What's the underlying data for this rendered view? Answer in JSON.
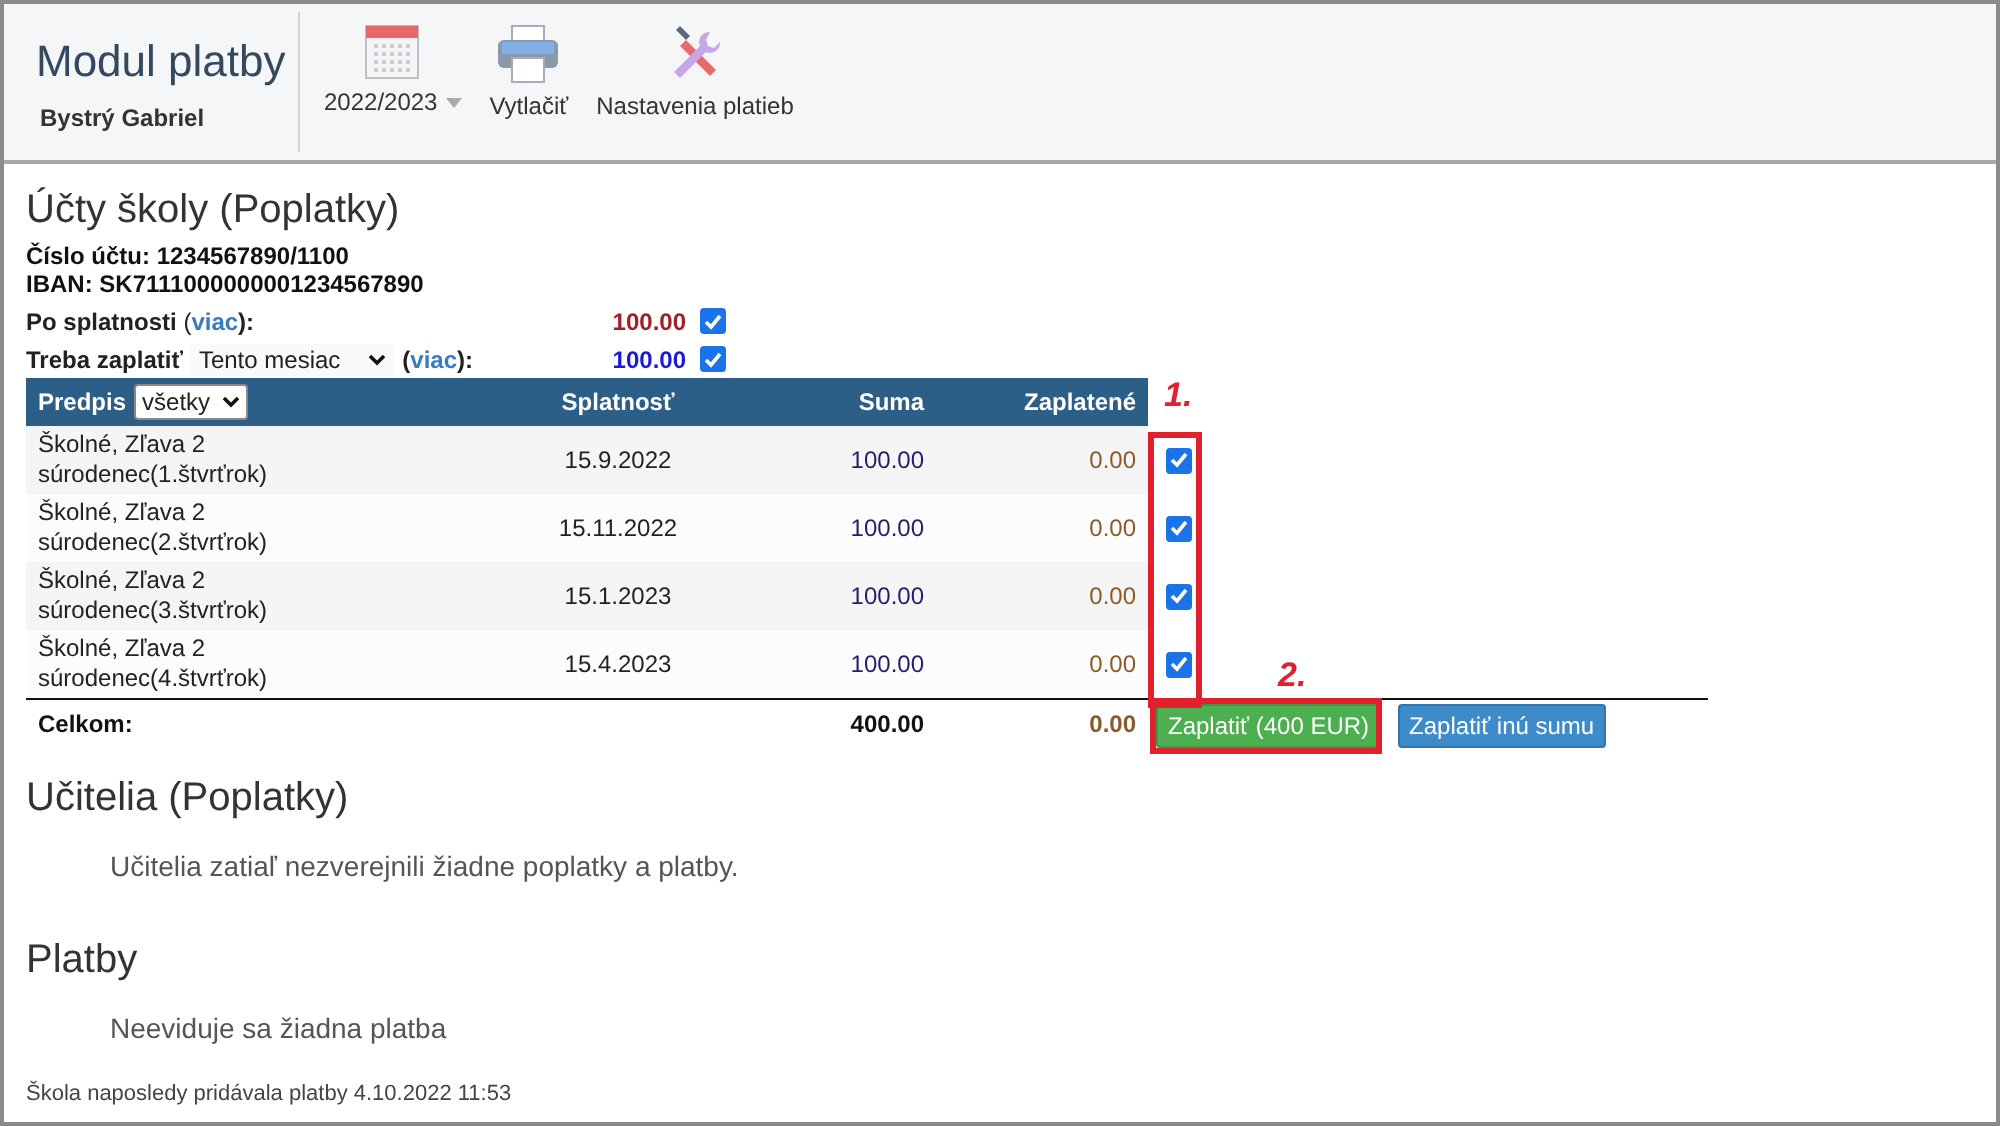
{
  "header": {
    "title": "Modul platby",
    "user": "Bystrý Gabriel",
    "tools": [
      {
        "kind": "calendar",
        "label": "2022/2023",
        "dropdown": true
      },
      {
        "kind": "printer",
        "label": "Vytlačiť",
        "dropdown": false
      },
      {
        "kind": "tools",
        "label": "Nastavenia platieb",
        "dropdown": false
      }
    ]
  },
  "accounts": {
    "heading": "Účty školy (Poplatky)",
    "account_number": "Číslo účtu: 1234567890/1100",
    "iban": "IBAN: SK7111000000001234567890",
    "overdue": {
      "label": "Po splatnosti",
      "open": "(",
      "link": "viac",
      "close": "):",
      "amount": "100.00",
      "checked": true
    },
    "to_pay": {
      "label": "Treba zaplatiť",
      "period": "Tento mesiac",
      "open": "(",
      "link": "viac",
      "close": "):",
      "amount": "100.00",
      "checked": true
    },
    "table": {
      "filter_label": "Predpis",
      "filter_value": "všetky",
      "columns": [
        "Splatnosť",
        "Suma",
        "Zaplatené"
      ],
      "rows": [
        {
          "item": "Školné, Zľava 2 súrodenec(1.štvrťrok)",
          "due": "15.9.2022",
          "amount": "100.00",
          "paid": "0.00",
          "checked": true
        },
        {
          "item": "Školné, Zľava 2 súrodenec(2.štvrťrok)",
          "due": "15.11.2022",
          "amount": "100.00",
          "paid": "0.00",
          "checked": true
        },
        {
          "item": "Školné, Zľava 2 súrodenec(3.štvrťrok)",
          "due": "15.1.2023",
          "amount": "100.00",
          "paid": "0.00",
          "checked": true
        },
        {
          "item": "Školné, Zľava 2 súrodenec(4.štvrťrok)",
          "due": "15.4.2023",
          "amount": "100.00",
          "paid": "0.00",
          "checked": true
        }
      ],
      "total": {
        "label": "Celkom:",
        "amount": "400.00",
        "paid": "0.00"
      }
    },
    "pay_button": "Zaplatiť (400 EUR)",
    "other_button": "Zaplatiť inú sumu",
    "annotations": [
      "1.",
      "2."
    ]
  },
  "teachers": {
    "heading": "Učitelia (Poplatky)",
    "message": "Učitelia zatiaľ nezverejnili žiadne poplatky a platby."
  },
  "payments": {
    "heading": "Platby",
    "message": "Neeviduje sa žiadna platba"
  },
  "footer": "Škola naposledy pridávala platby 4.10.2022 11:53"
}
